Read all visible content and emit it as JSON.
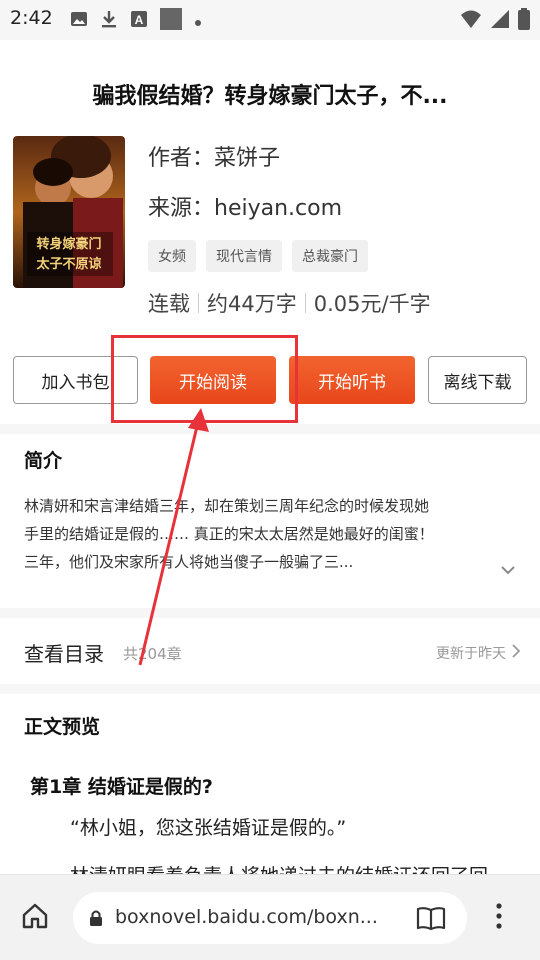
{
  "status_bar": {
    "time": "2:42",
    "icons": [
      "image-icon",
      "download-icon",
      "a-box-icon",
      "square-icon",
      "dot-icon"
    ],
    "right_icons": [
      "wifi-icon",
      "signal-icon",
      "battery-icon"
    ]
  },
  "book": {
    "title": "骗我假结婚？转身嫁豪门太子，不...",
    "author_line": "作者：菜饼子",
    "source_line": "来源：heiyan.com",
    "tags": [
      "女频",
      "现代言情",
      "总裁豪门"
    ],
    "status": "连载",
    "words": "约44万字",
    "price": "0.05元/千字",
    "cover_text": "转身嫁豪门太子不原谅"
  },
  "actions": {
    "add_shelf": "加入书包",
    "start_read": "开始阅读",
    "start_listen": "开始听书",
    "offline_download": "离线下载"
  },
  "intro": {
    "heading": "简介",
    "line1": "林清妍和宋言津结婚三年，却在策划三周年纪念的时候发现她",
    "line2": "手里的结婚证是假的…… 真正的宋太太居然是她最好的闺蜜！",
    "line3": "三年，他们及宋家所有人将她当傻子一般骗了三..."
  },
  "toc": {
    "label": "查看目录",
    "count": "共204章",
    "updated": "更新于昨天"
  },
  "preview": {
    "heading": "正文预览",
    "chapter_title": "第1章 结婚证是假的?",
    "para1": "“林小姐，您这张结婚证是假的。”",
    "para2": "林清妍眼看着负责人将她递过去的结婚证还回了回"
  },
  "browser": {
    "url": "boxnovel.baidu.com/boxn..."
  },
  "colors": {
    "accent": "#e8461b",
    "annotation": "#e8323a"
  }
}
